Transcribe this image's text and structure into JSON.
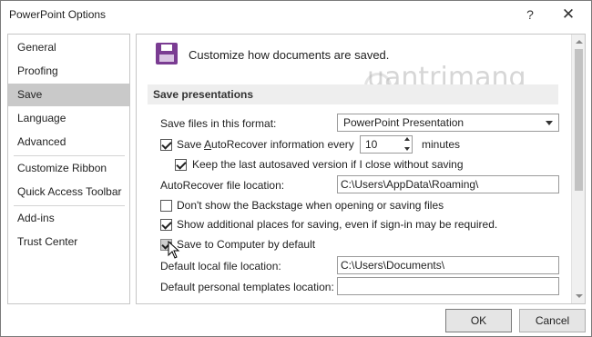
{
  "window": {
    "title": "PowerPoint Options",
    "help_glyph": "?",
    "close_glyph": "✕"
  },
  "nav": {
    "items": [
      {
        "label": "General"
      },
      {
        "label": "Proofing"
      },
      {
        "label": "Save"
      },
      {
        "label": "Language"
      },
      {
        "label": "Advanced"
      },
      {
        "label": "Customize Ribbon"
      },
      {
        "label": "Quick Access Toolbar"
      },
      {
        "label": "Add-ins"
      },
      {
        "label": "Trust Center"
      }
    ],
    "selected": "Save"
  },
  "pane": {
    "header": "Customize how documents are saved.",
    "watermark": "uantrimang",
    "section_title": "Save presentations",
    "format_label": "Save files in this format:",
    "format_value": "PowerPoint Presentation",
    "autorecover_label_pre": "Save ",
    "autorecover_label_u": "A",
    "autorecover_label_post": "utoRecover information every",
    "autorecover_minutes": "10",
    "minutes_label": "minutes",
    "keep_last_label": "Keep the last autosaved version if I close without saving",
    "autorecover_loc_label": "AutoRecover file location:",
    "autorecover_loc_value": "C:\\Users\\AppData\\Roaming\\",
    "backstage_label": "Don't show the Backstage when opening or saving files",
    "additional_places_label": "Show additional places for saving, even if sign-in may be required.",
    "save_to_computer_label": "Save to Computer by default",
    "default_local_label": "Default local file location:",
    "default_local_value": "C:\\Users\\Documents\\",
    "default_templates_label": "Default personal templates location:",
    "default_templates_value": "",
    "checks": {
      "autorecover": true,
      "keep_last": true,
      "backstage": false,
      "additional_places": true,
      "save_to_computer": true
    }
  },
  "buttons": {
    "ok": "OK",
    "cancel": "Cancel"
  },
  "colors": {
    "save_icon": "#7a3c92",
    "nav_selected": "#c9c9c9",
    "section_band": "#eeeeee"
  },
  "icons": [
    "save-icon",
    "help-icon",
    "close-icon",
    "dropdown-arrow-icon",
    "spin-up-icon",
    "spin-down-icon",
    "mouse-cursor-icon"
  ]
}
